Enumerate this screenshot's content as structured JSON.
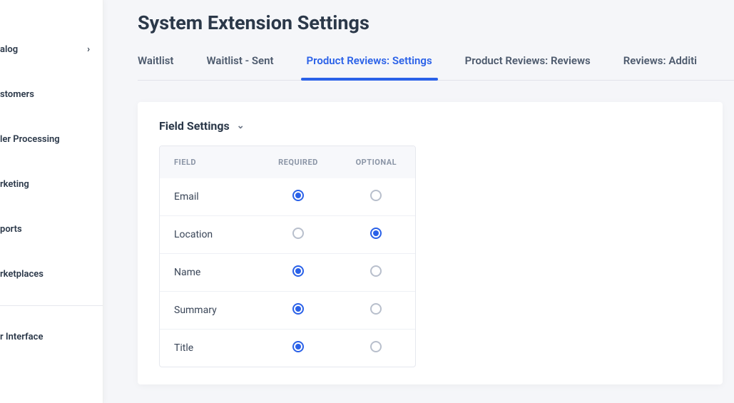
{
  "sidebar": {
    "items": [
      {
        "label": "alog",
        "has_chevron": true
      },
      {
        "label": "stomers",
        "has_chevron": false
      },
      {
        "label": "ler Processing",
        "has_chevron": false
      },
      {
        "label": "rketing",
        "has_chevron": false
      },
      {
        "label": "ports",
        "has_chevron": false
      },
      {
        "label": "rketplaces",
        "has_chevron": false
      },
      {
        "label": "r Interface",
        "has_chevron": false
      }
    ]
  },
  "page": {
    "title": "System Extension Settings"
  },
  "tabs": [
    {
      "label": "Waitlist",
      "active": false
    },
    {
      "label": "Waitlist - Sent",
      "active": false
    },
    {
      "label": "Product Reviews: Settings",
      "active": true
    },
    {
      "label": "Product Reviews: Reviews",
      "active": false
    },
    {
      "label": "Reviews: Additi",
      "active": false
    }
  ],
  "panel": {
    "title": "Field Settings",
    "columns": {
      "field": "Field",
      "required": "Required",
      "optional": "Optional"
    },
    "rows": [
      {
        "field": "Email",
        "selected": "required"
      },
      {
        "field": "Location",
        "selected": "optional"
      },
      {
        "field": "Name",
        "selected": "required"
      },
      {
        "field": "Summary",
        "selected": "required"
      },
      {
        "field": "Title",
        "selected": "required"
      }
    ]
  }
}
